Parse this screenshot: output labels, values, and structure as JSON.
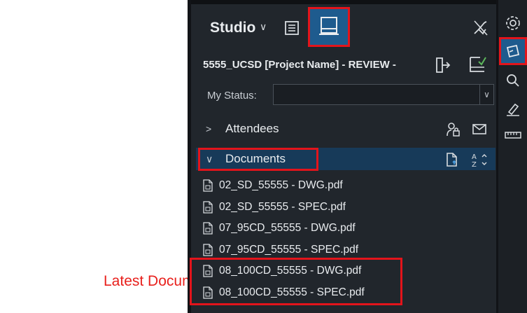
{
  "callout": {
    "label": "Latest Documents →",
    "color": "#e8201c"
  },
  "header": {
    "title": "Studio",
    "icons": [
      "chevron-down-icon",
      "list-view-icon",
      "layout-view-icon",
      "unpin-icon"
    ]
  },
  "project": {
    "name": "5555_UCSD [Project Name] - REVIEW -",
    "icons": [
      "leave-session-icon",
      "finish-review-icon"
    ]
  },
  "status": {
    "label": "My Status:",
    "value": ""
  },
  "sections": {
    "attendees": {
      "label": "Attendees",
      "icons": [
        "attendee-permissions-icon",
        "mail-icon"
      ]
    },
    "documents": {
      "label": "Documents",
      "icons": [
        "add-document-icon",
        "sort-az-icon"
      ],
      "items": [
        "02_SD_55555 - DWG.pdf",
        "02_SD_55555 - SPEC.pdf",
        "07_95CD_55555 - DWG.pdf",
        "07_95CD_55555 - SPEC.pdf",
        "08_100CD_55555 - DWG.pdf",
        "08_100CD_55555 - SPEC.pdf"
      ]
    }
  },
  "rail": {
    "icons": [
      "settings-icon",
      "studio-icon",
      "search-icon",
      "markup-icon",
      "measure-icon"
    ],
    "active": "studio-icon"
  },
  "colors": {
    "panel_bg": "#21262c",
    "accent": "#1e5b8e",
    "highlight": "#e3141b",
    "text": "#e9ecef"
  }
}
